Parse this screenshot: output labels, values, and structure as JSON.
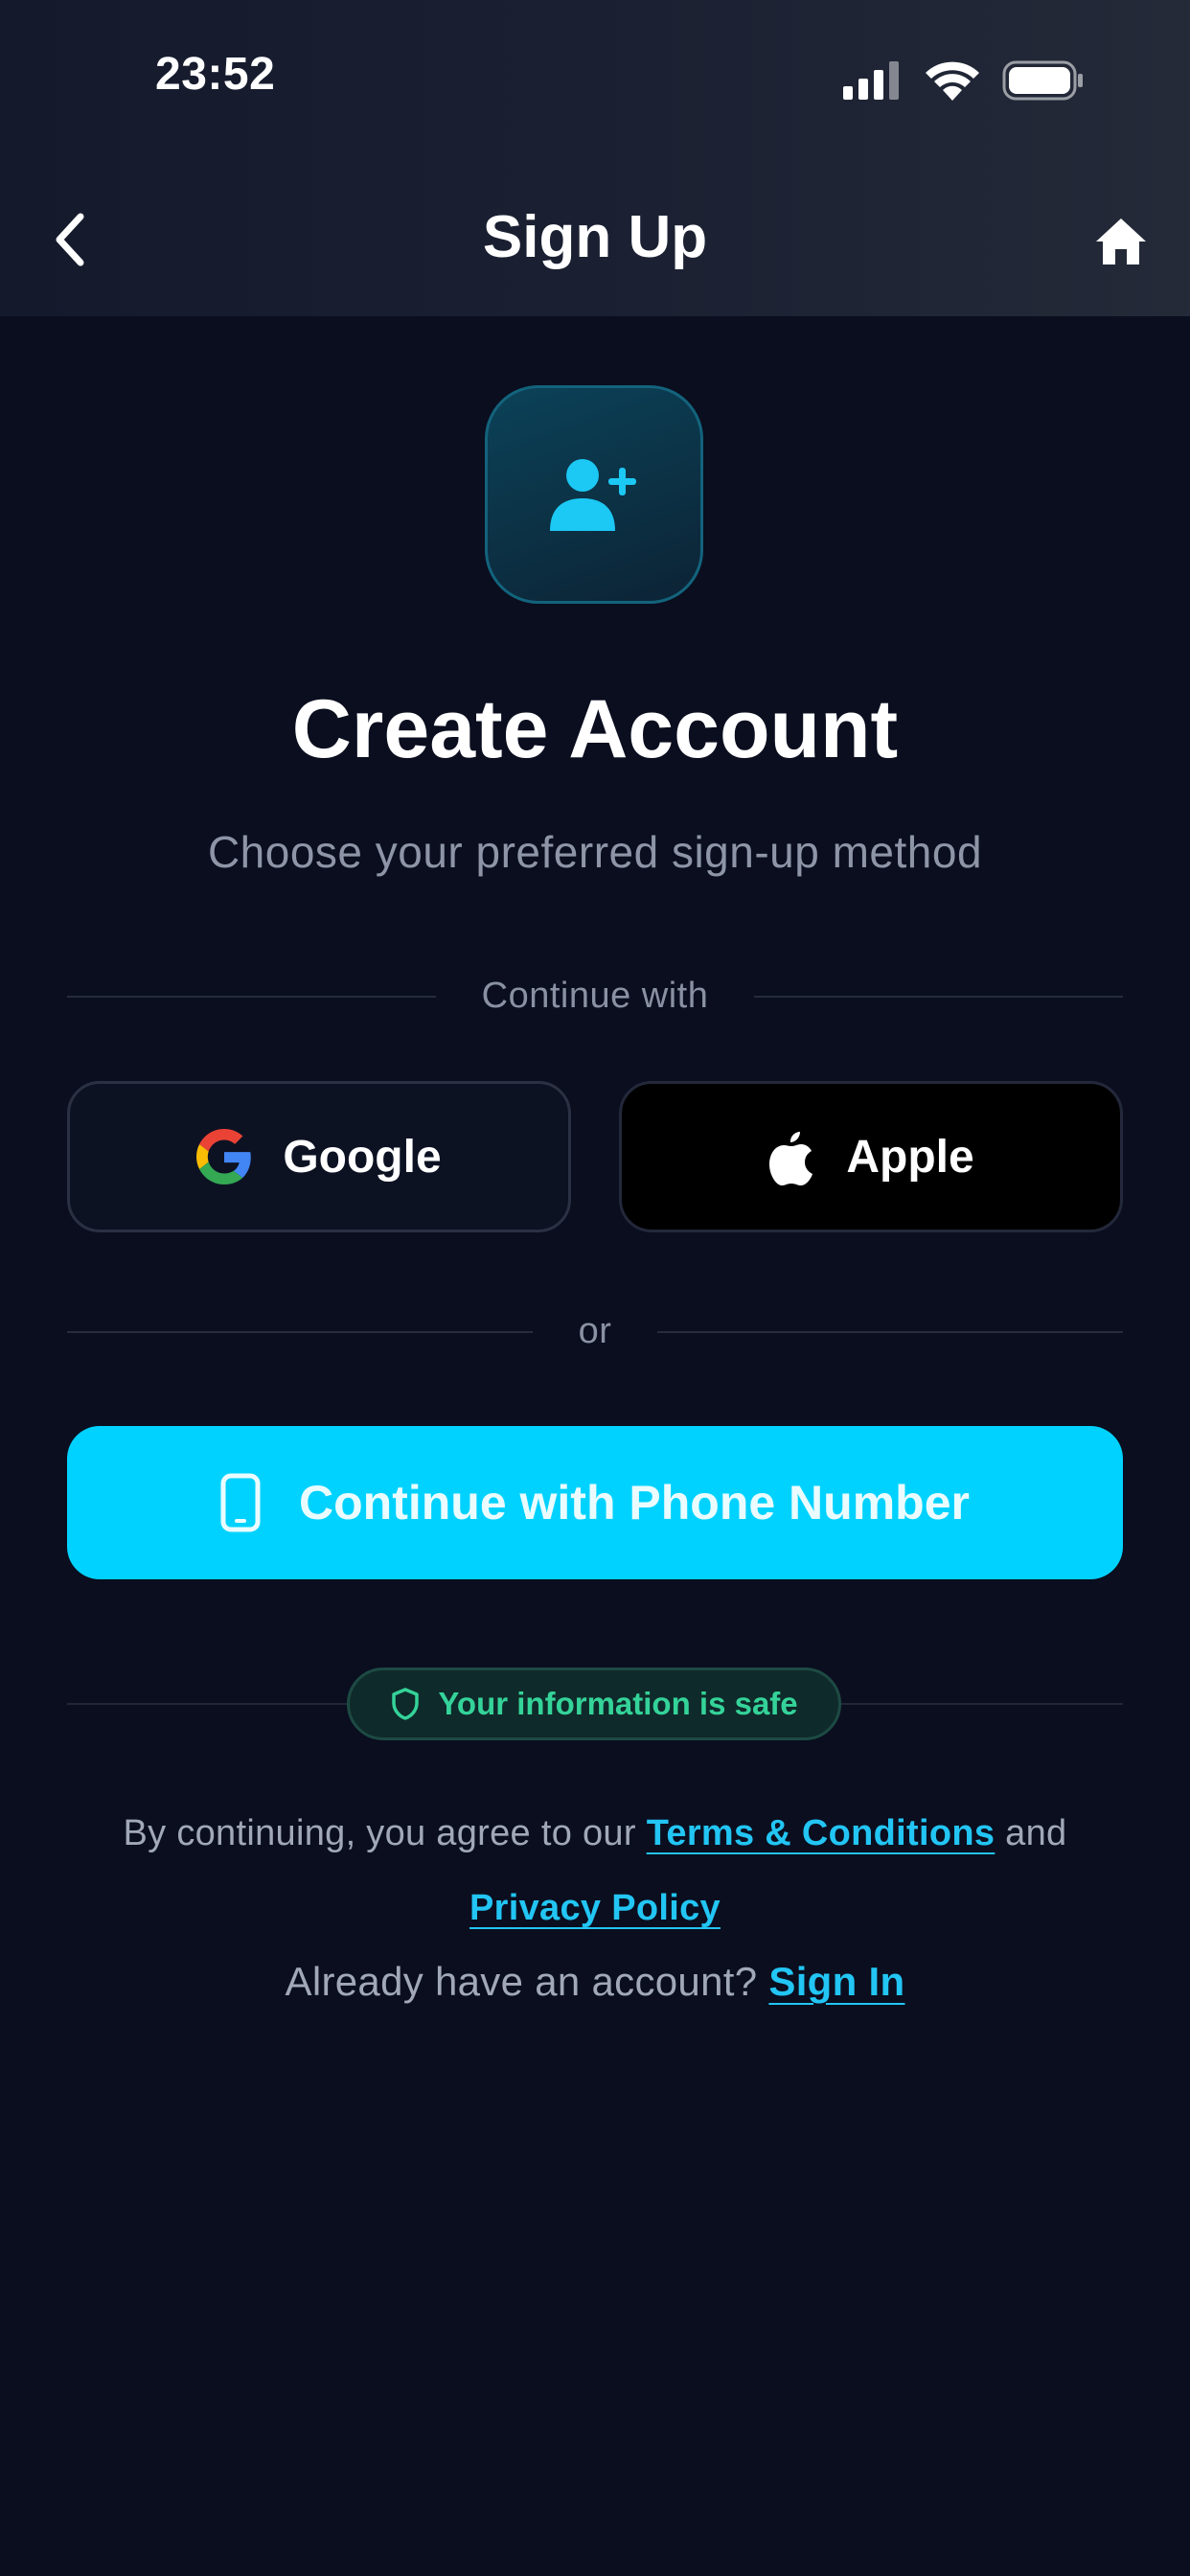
{
  "status_bar": {
    "time": "23:52"
  },
  "nav": {
    "title": "Sign Up"
  },
  "hero": {
    "title": "Create Account",
    "subtitle": "Choose your preferred sign-up method"
  },
  "social": {
    "divider_label": "Continue with",
    "google_label": "Google",
    "apple_label": "Apple"
  },
  "or_label": "or",
  "phone_button_label": "Continue with Phone Number",
  "safe_badge": "Your information is safe",
  "legal": {
    "prefix": "By continuing, you agree to our",
    "terms_link": "Terms & Conditions",
    "and": "and",
    "privacy_link": "Privacy Policy"
  },
  "signin": {
    "prompt": "Already have an account?",
    "link": "Sign In"
  },
  "colors": {
    "background": "#0a0e1f",
    "accent": "#00d2ff",
    "link": "#22c5f3",
    "safe_green": "#34d399"
  }
}
